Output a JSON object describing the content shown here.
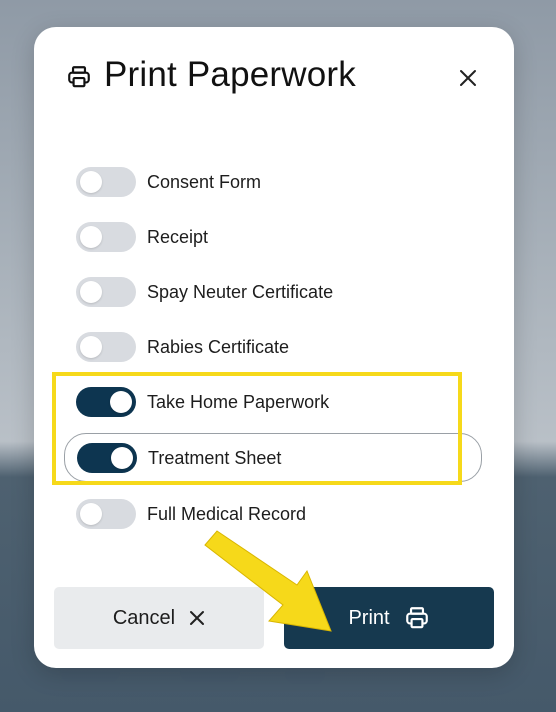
{
  "dialog": {
    "title": "Print Paperwork",
    "close_icon": "close-icon",
    "header_icon": "printer-icon"
  },
  "options": [
    {
      "label": "Consent Form",
      "checked": false
    },
    {
      "label": "Receipt",
      "checked": false
    },
    {
      "label": "Spay Neuter Certificate",
      "checked": false
    },
    {
      "label": "Rabies Certificate",
      "checked": false
    },
    {
      "label": "Take Home Paperwork",
      "checked": true
    },
    {
      "label": "Treatment Sheet",
      "checked": true
    },
    {
      "label": "Full Medical Record",
      "checked": false
    }
  ],
  "buttons": {
    "cancel_label": "Cancel",
    "print_label": "Print"
  },
  "colors": {
    "toggle_on": "#0d3550",
    "toggle_off": "#d8dbe0",
    "print_button": "#16394f",
    "highlight": "#f6d91a"
  }
}
